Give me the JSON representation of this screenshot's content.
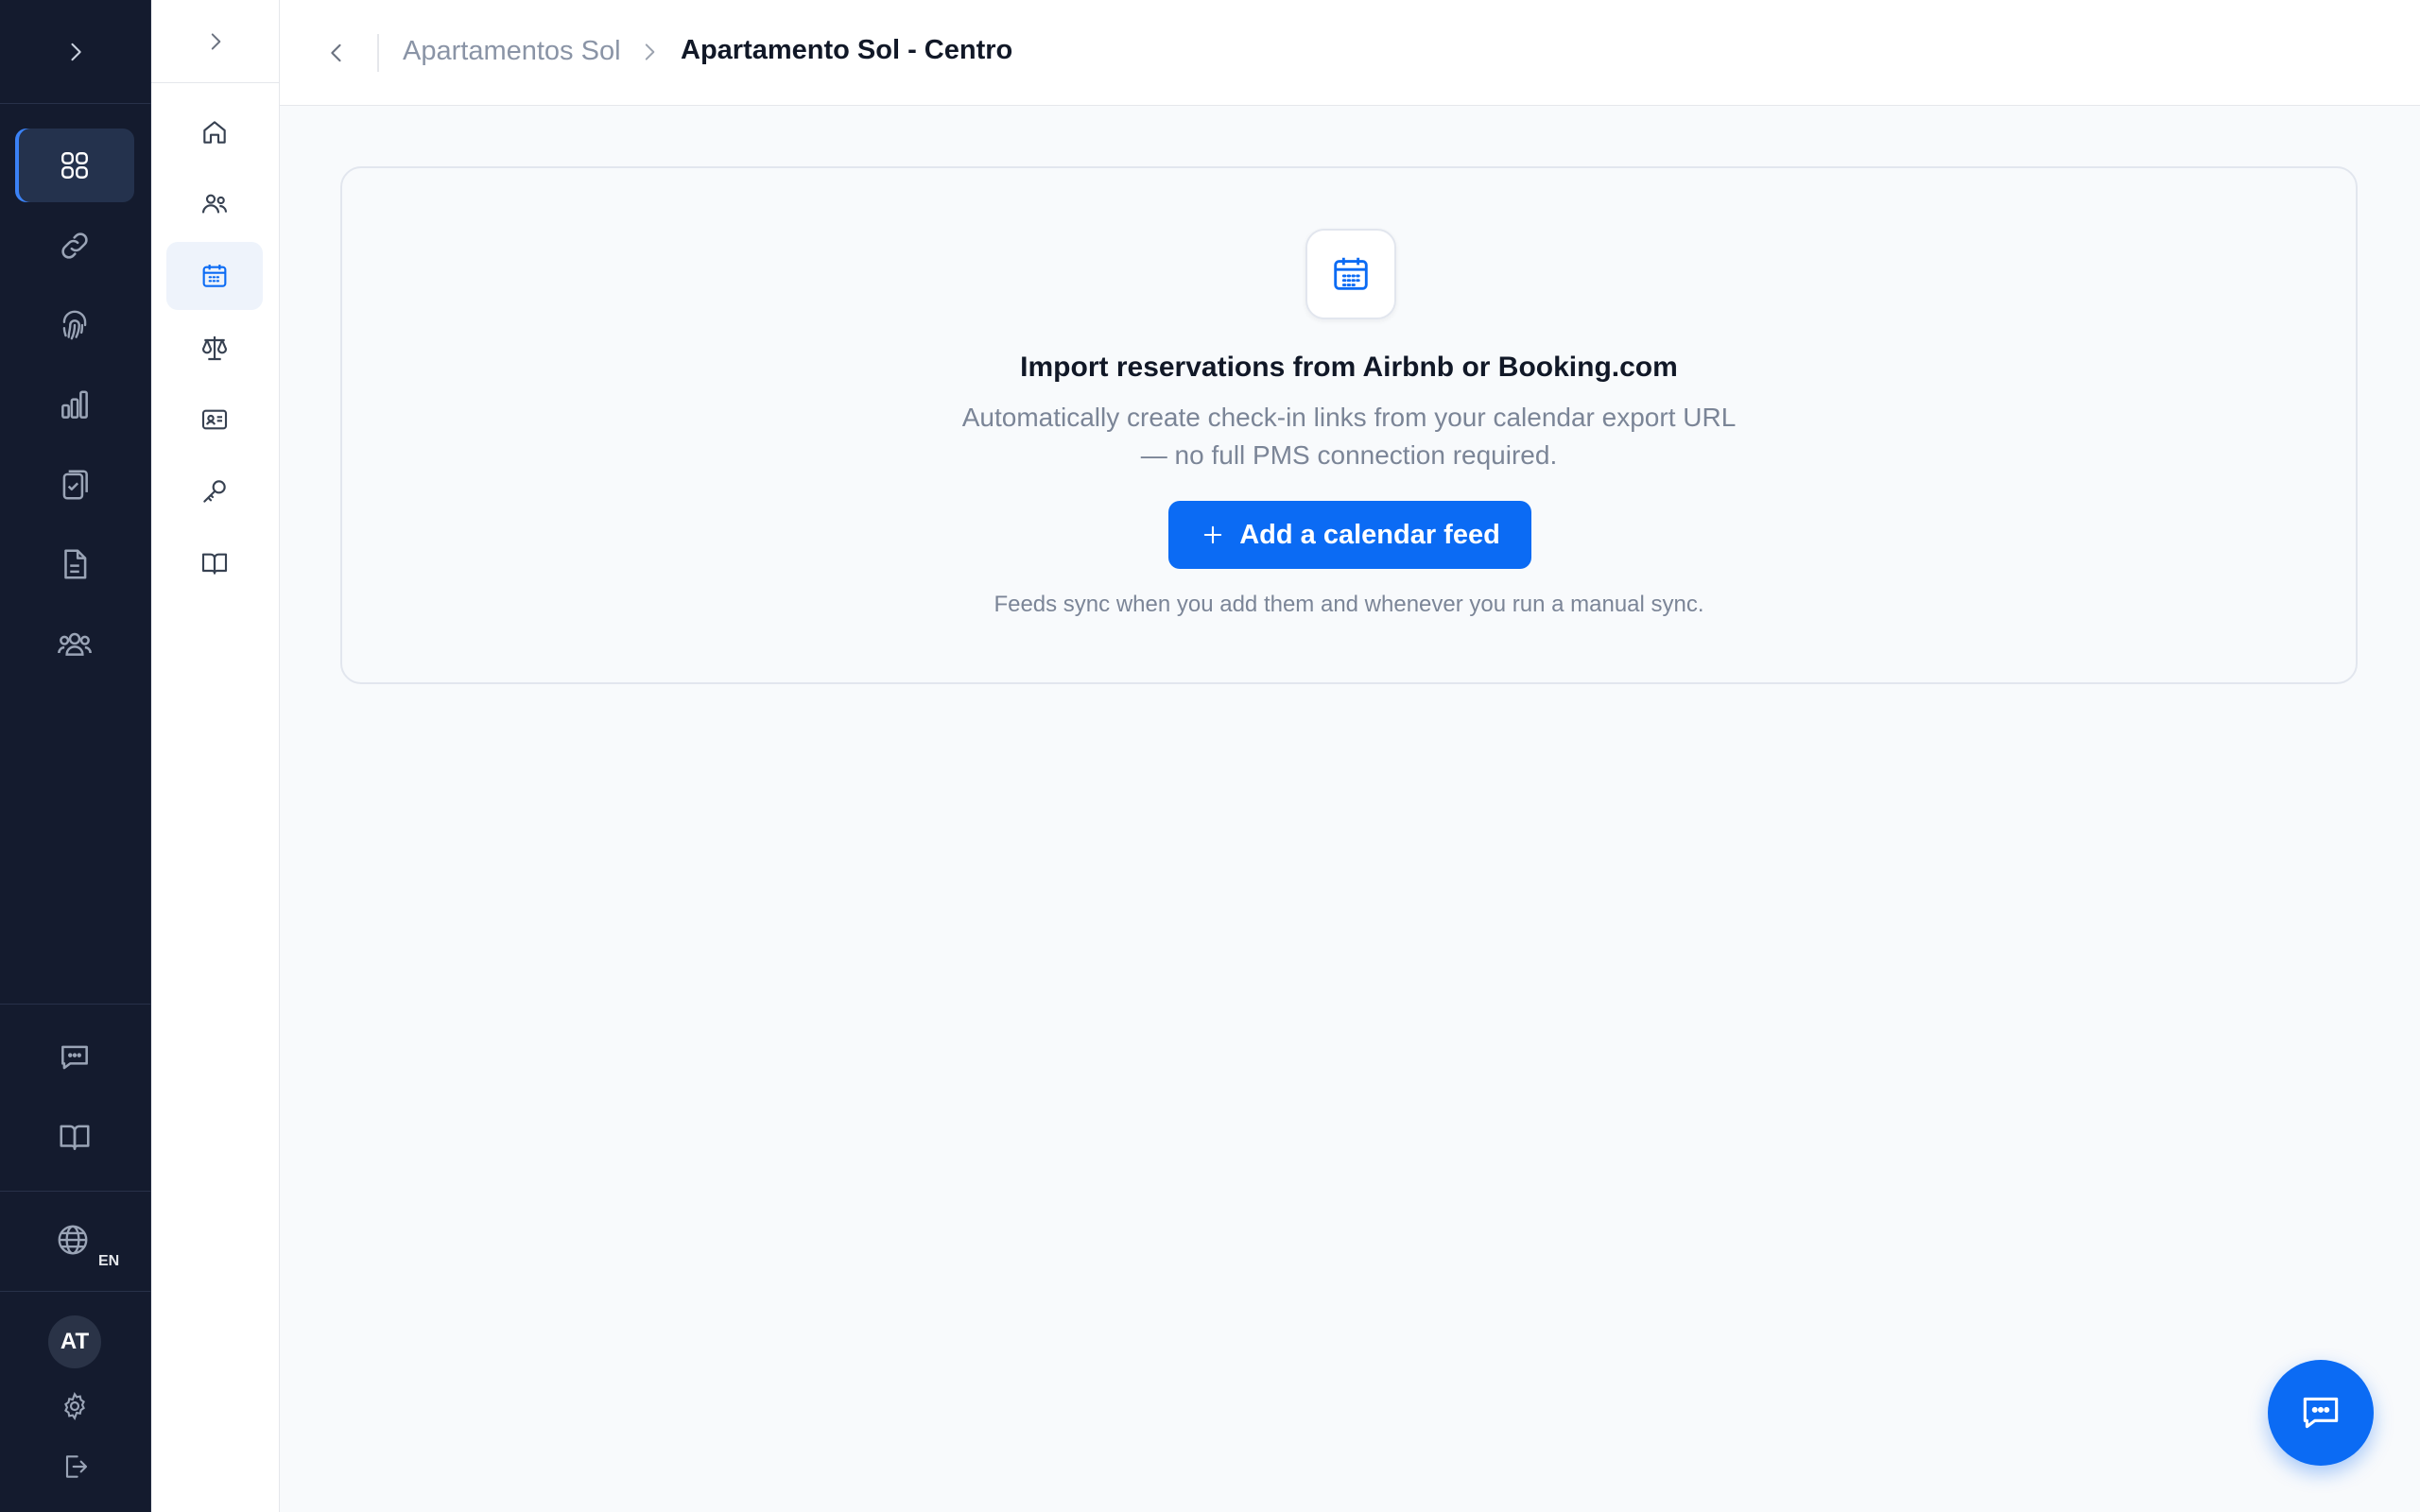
{
  "rail": {
    "expand_icon": "chevron-right-icon",
    "nav": [
      {
        "icon": "grid-icon",
        "active": true
      },
      {
        "icon": "link-icon"
      },
      {
        "icon": "fingerprint-icon"
      },
      {
        "icon": "bar-chart-icon"
      },
      {
        "icon": "clipboard-check-icon"
      },
      {
        "icon": "document-icon"
      },
      {
        "icon": "users-group-icon"
      }
    ],
    "bottom": [
      {
        "icon": "chat-icon"
      },
      {
        "icon": "book-open-icon"
      }
    ],
    "language": {
      "icon": "globe-icon",
      "label": "EN"
    },
    "user": {
      "initials": "AT"
    },
    "settings_icon": "gear-icon",
    "logout_icon": "logout-icon"
  },
  "subrail": {
    "expand_icon": "chevron-right-icon",
    "items": [
      {
        "icon": "home-icon"
      },
      {
        "icon": "users-icon"
      },
      {
        "icon": "calendar-icon",
        "active": true
      },
      {
        "icon": "scale-icon"
      },
      {
        "icon": "id-card-icon"
      },
      {
        "icon": "key-icon"
      },
      {
        "icon": "book-icon"
      }
    ]
  },
  "breadcrumb": {
    "parent": "Apartamentos Sol",
    "current": "Apartamento Sol - Centro"
  },
  "empty_state": {
    "icon": "calendar-icon",
    "title": "Import reservations from Airbnb or Booking.com",
    "description_line1": "Automatically create check-in links from your calendar export URL",
    "description_line2": "— no full PMS connection required.",
    "cta_label": "Add a calendar feed",
    "note": "Feeds sync when you add them and whenever you run a manual sync."
  },
  "colors": {
    "accent": "#0b6bf4",
    "sidebar_bg": "#141b2e",
    "page_bg": "#f8fafc"
  }
}
